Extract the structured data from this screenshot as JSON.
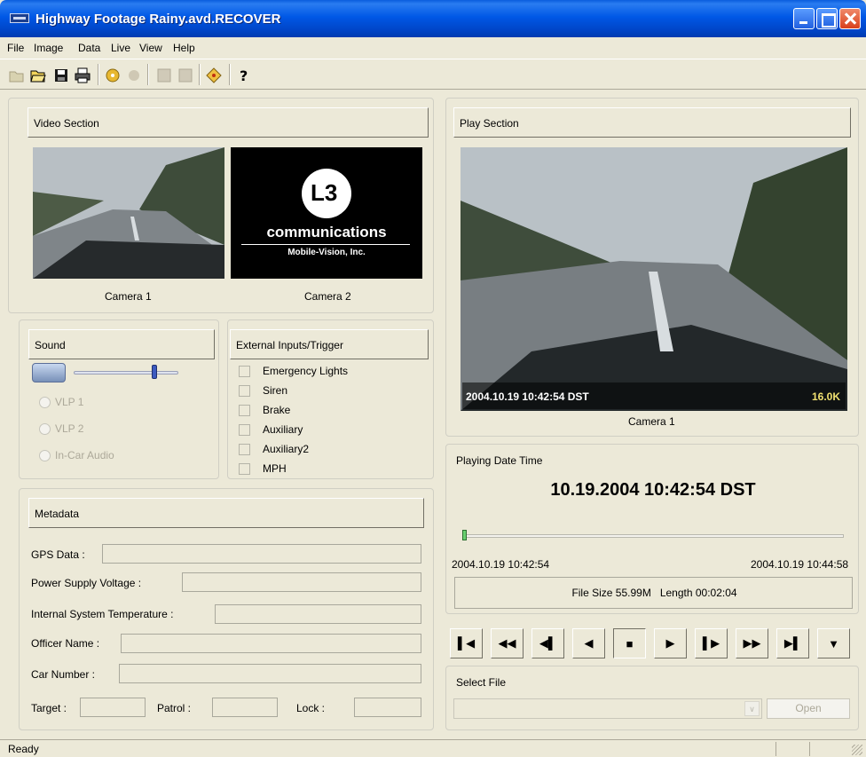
{
  "window": {
    "title": "Highway Footage Rainy.avd.RECOVER"
  },
  "menu": [
    "File",
    "Image",
    "Data",
    "Live",
    "View",
    "Help"
  ],
  "video_section": {
    "header": "Video Section",
    "cam1_label": "Camera 1",
    "cam2_label": "Camera 2",
    "logo_mark": "L3",
    "logo_text": "communications",
    "logo_sub": "Mobile-Vision, Inc."
  },
  "sound": {
    "header": "Sound",
    "volume_level": 0.77,
    "options": [
      "VLP 1",
      "VLP 2",
      "In-Car Audio"
    ]
  },
  "external": {
    "header": "External Inputs/Trigger",
    "items": [
      "Emergency Lights",
      "Siren",
      "Brake",
      "Auxiliary",
      "Auxiliary2",
      "MPH"
    ]
  },
  "metadata": {
    "header": "Metadata",
    "gps": "GPS Data :",
    "voltage": "Power Supply Voltage :",
    "temp": "Internal System Temperature :",
    "officer": "Officer Name :",
    "car": "Car Number :",
    "target": "Target :",
    "patrol": "Patrol :",
    "lock": "Lock :"
  },
  "play": {
    "header": "Play Section",
    "overlay_time": "2004.10.19 10:42:54 DST",
    "overlay_rate": "16.0K",
    "camera_label": "Camera 1"
  },
  "datetime": {
    "label": "Playing Date Time",
    "value": "10.19.2004 10:42:54 DST",
    "start": "2004.10.19 10:42:54",
    "end": "2004.10.19 10:44:58",
    "file_info": "File Size 55.99M   Length 00:02:04",
    "progress": 0.0
  },
  "select_file": {
    "label": "Select File",
    "open_label": "Open"
  },
  "status": {
    "text": "Ready"
  },
  "colors": {
    "title_blue": "#0058e6",
    "dialog": "#ece9d8",
    "disabled": "#aca899"
  }
}
